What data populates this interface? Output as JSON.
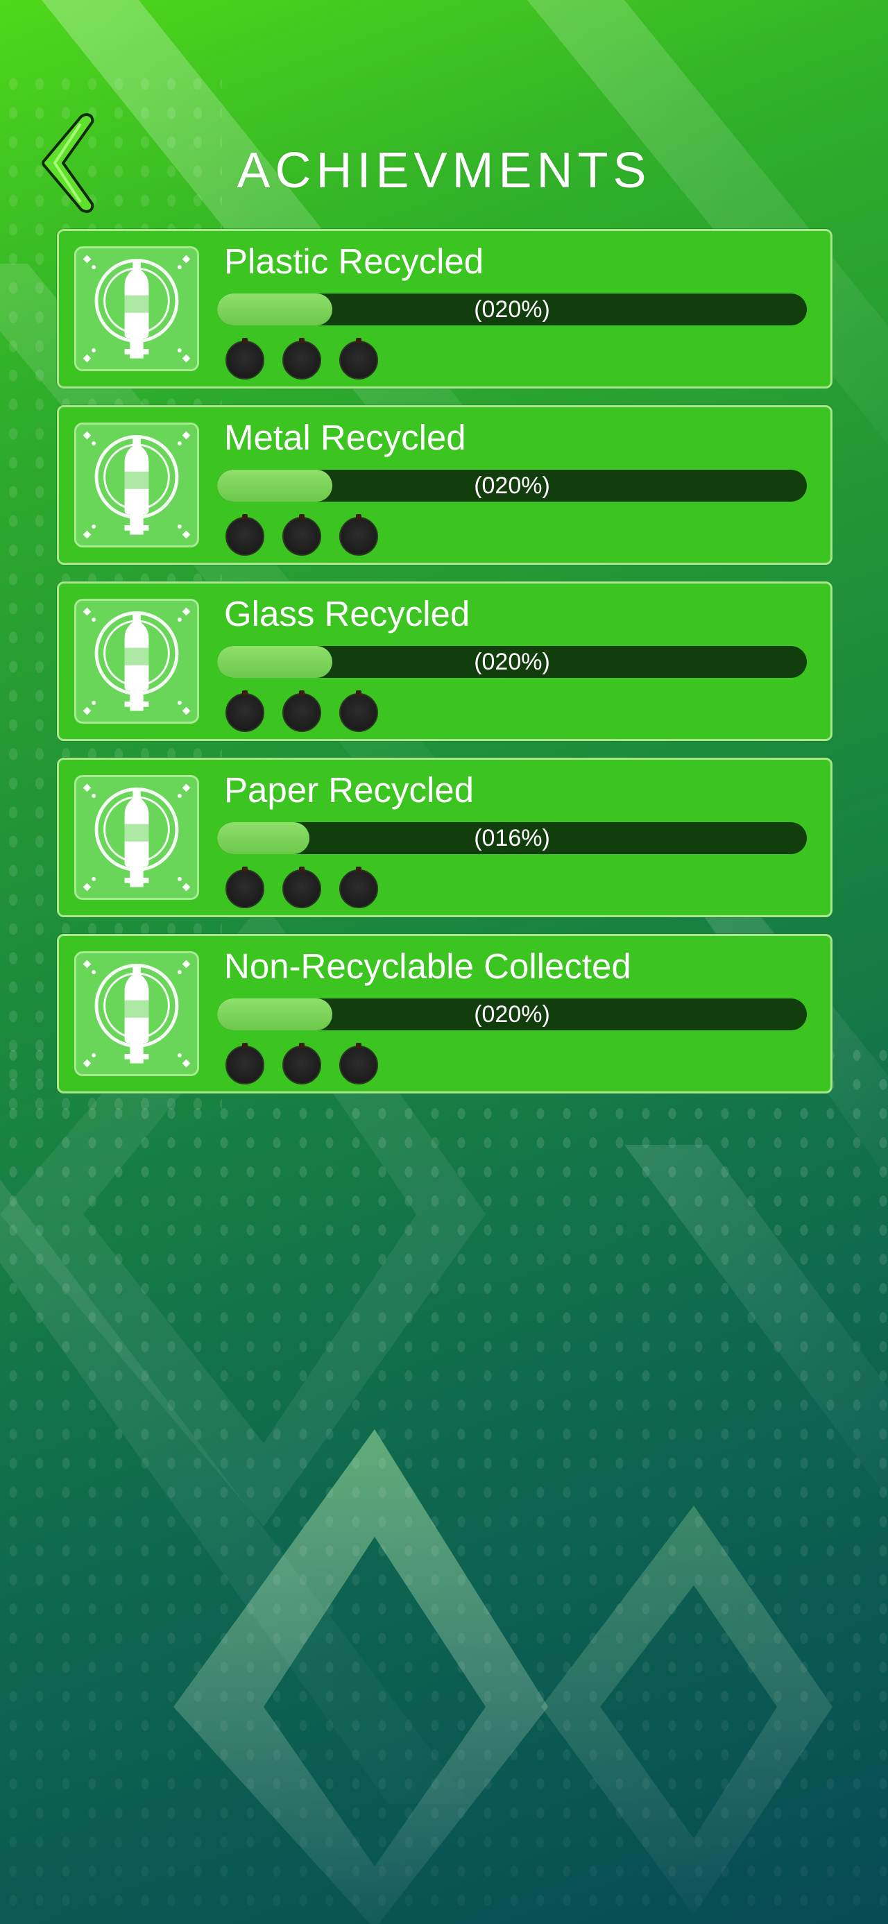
{
  "header": {
    "title": "ACHIEVMENTS",
    "back_icon": "chevron-left-icon"
  },
  "achievements": [
    {
      "label": "Plastic Recycled",
      "progress_text": "(020%)",
      "progress": 0.2,
      "medals": 3,
      "icon": "bottle-badge-icon"
    },
    {
      "label": "Metal Recycled",
      "progress_text": "(020%)",
      "progress": 0.2,
      "medals": 3,
      "icon": "bottle-badge-icon"
    },
    {
      "label": "Glass Recycled",
      "progress_text": "(020%)",
      "progress": 0.2,
      "medals": 3,
      "icon": "bottle-badge-icon"
    },
    {
      "label": "Paper Recycled",
      "progress_text": "(016%)",
      "progress": 0.16,
      "medals": 3,
      "icon": "bottle-badge-icon"
    },
    {
      "label": "Non-Recyclable Collected",
      "progress_text": "(020%)",
      "progress": 0.2,
      "medals": 3,
      "icon": "bottle-badge-icon"
    }
  ],
  "colors": {
    "card": "#3cc421",
    "bar_track": "#123d0c",
    "bar_fill": "#7fd65e",
    "medal": "#1c1c1c"
  }
}
